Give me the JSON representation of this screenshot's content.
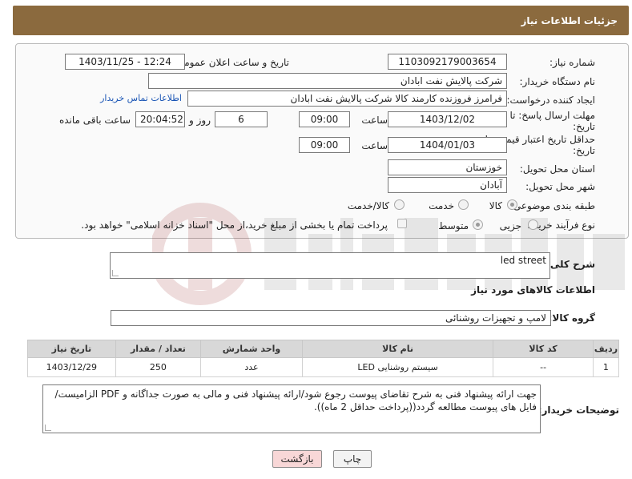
{
  "header": {
    "title": "جزئیات اطلاعات نیاز"
  },
  "form": {
    "need_number_label": "شماره نیاز:",
    "need_number": "1103092179003654",
    "announce_label": "تاریخ و ساعت اعلان عمومی:",
    "announce_value": "1403/11/25 - 12:24",
    "buyer_org_label": "نام دستگاه خریدار:",
    "buyer_org": "شرکت پالایش نفت ابادان",
    "requester_label": "ایجاد کننده درخواست:",
    "requester": "فرامرز فروزنده کارمند کالا شرکت پالایش نفت ابادان",
    "contact_link": "اطلاعات تماس خریدار",
    "reply_deadline_label_1": "مهلت ارسال پاسخ: تا",
    "reply_deadline_label_2": "تاریخ:",
    "reply_date": "1403/12/02",
    "time_label": "ساعت",
    "reply_time": "09:00",
    "days_value": "6",
    "days_label": "روز و",
    "remaining_time": "20:04:52",
    "remaining_label": "ساعت باقی مانده",
    "price_validity_label_1": "حداقل تاریخ اعتبار قیمت: تا",
    "price_validity_label_2": "تاریخ:",
    "price_date": "1404/01/03",
    "price_time": "09:00",
    "province_label": "استان محل تحویل:",
    "province": "خوزستان",
    "city_label": "شهر محل تحویل:",
    "city": "آبادان",
    "category_label": "طبقه بندی موضوعی:",
    "category_options": [
      "کالا",
      "خدمت",
      "کالا/خدمت"
    ],
    "category_selected": "کالا",
    "purchase_type_label": "نوع فرآیند خرید :",
    "purchase_options": [
      "جزیی",
      "متوسط"
    ],
    "purchase_selected": "متوسط",
    "payment_note": "پرداخت تمام یا بخشی از مبلغ خرید،از محل \"اسناد خزانه اسلامی\" خواهد بود."
  },
  "summary": {
    "general_desc_label": "شرح کلی نیاز:",
    "general_desc": "led street",
    "goods_info_title": "اطلاعات کالاهای مورد نیاز",
    "goods_group_label": "گروه کالا:",
    "goods_group": "لامپ و تجهیزات روشنائی"
  },
  "table": {
    "headers": [
      "ردیف",
      "کد کالا",
      "نام کالا",
      "واحد شمارش",
      "تعداد / مقدار",
      "تاریخ نیاز"
    ],
    "rows": [
      [
        "1",
        "--",
        "سیستم روشنایی LED",
        "عدد",
        "250",
        "1403/12/29"
      ]
    ]
  },
  "buyer_notes": {
    "label": "توضیحات خریدار:",
    "text": "جهت ارائه پیشنهاد فنی به شرح تقاضای پیوست رجوع شود/ارائه پیشنهاد فنی و مالی به صورت جداگانه و PDF الزامیست/ فایل های پیوست مطالعه گردد((پرداخت حداقل 2 ماه))."
  },
  "buttons": {
    "print": "چاپ",
    "back": "بازگشت"
  },
  "colors": {
    "header_bg": "#8b6a3e",
    "back_bg": "#f8d7d7",
    "link": "#1a55b5"
  }
}
